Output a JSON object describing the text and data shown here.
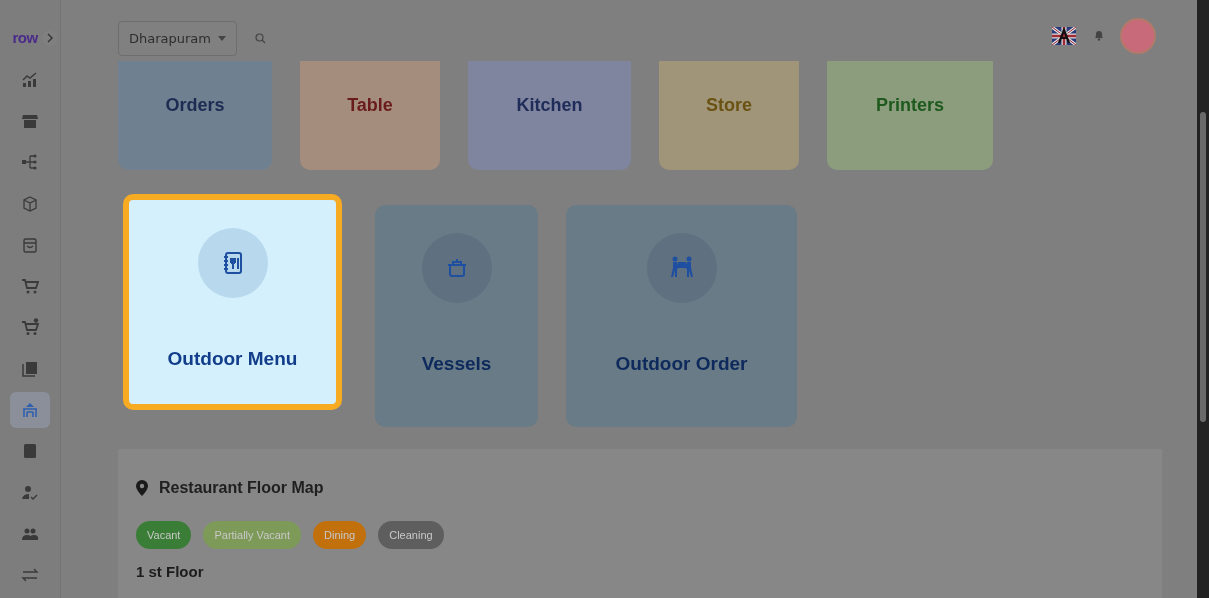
{
  "sidebar": {
    "logo": "row",
    "items": [
      {
        "selected": false
      },
      {
        "selected": false
      },
      {
        "selected": false
      },
      {
        "selected": false
      },
      {
        "selected": false
      },
      {
        "selected": false
      },
      {
        "selected": false
      },
      {
        "selected": false
      },
      {
        "selected": true
      },
      {
        "selected": false
      },
      {
        "selected": false
      },
      {
        "selected": false
      },
      {
        "selected": false
      }
    ]
  },
  "topbar": {
    "location": "Dharapuram"
  },
  "modules": [
    {
      "label": "Orders"
    },
    {
      "label": "Table"
    },
    {
      "label": "Kitchen"
    },
    {
      "label": "Store"
    },
    {
      "label": "Printers"
    }
  ],
  "actions": [
    {
      "label": "Outdoor Menu",
      "highlighted": true
    },
    {
      "label": "Vessels",
      "highlighted": false
    },
    {
      "label": "Outdoor Order",
      "highlighted": false
    }
  ],
  "floor_map": {
    "title": "Restaurant Floor Map",
    "legend": [
      {
        "label": "Vacant",
        "color": "#3a7d37"
      },
      {
        "label": "Partially Vacant",
        "color": "#7d9a58"
      },
      {
        "label": "Dining",
        "color": "#c2700c"
      },
      {
        "label": "Cleaning",
        "color": "#5e5e5e"
      }
    ],
    "floor": "1 st Floor"
  }
}
